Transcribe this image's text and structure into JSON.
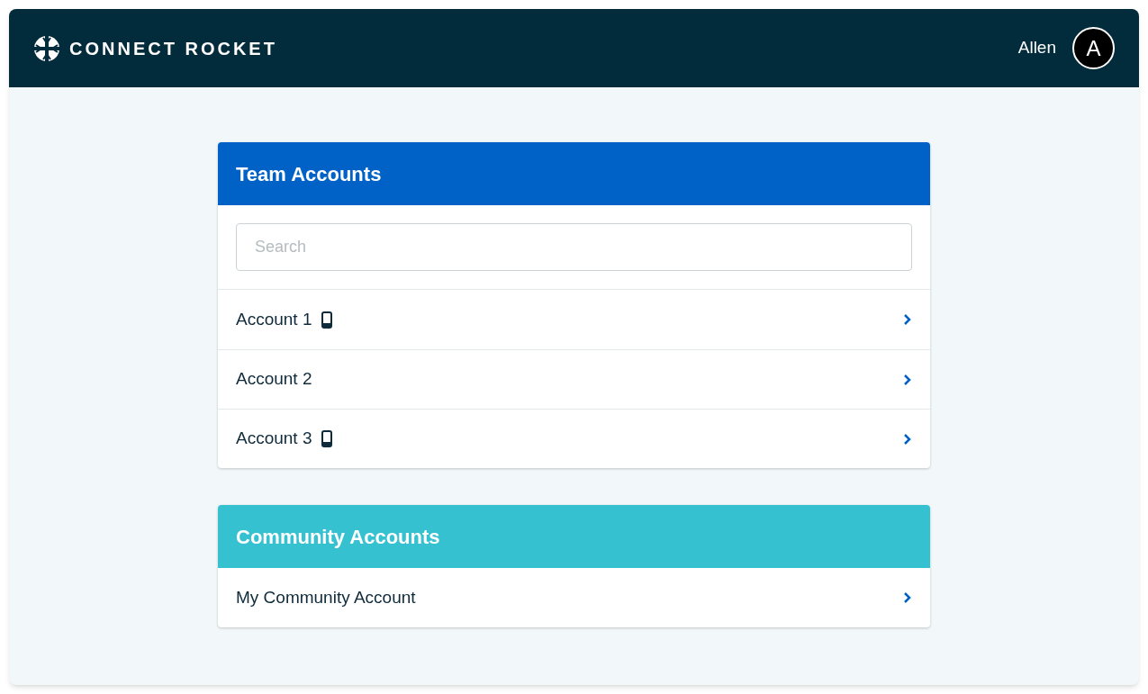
{
  "header": {
    "brand": "CONNECT ROCKET",
    "user_name": "Allen",
    "avatar_initial": "A"
  },
  "sections": [
    {
      "title": "Team Accounts",
      "color": "#0061c6",
      "search": {
        "placeholder": "Search"
      },
      "items": [
        {
          "label": "Account 1",
          "mobile": true
        },
        {
          "label": "Account 2",
          "mobile": false
        },
        {
          "label": "Account 3",
          "mobile": true
        }
      ]
    },
    {
      "title": "Community Accounts",
      "color": "#36c1d1",
      "items": [
        {
          "label": "My Community Account",
          "mobile": false
        }
      ]
    }
  ]
}
